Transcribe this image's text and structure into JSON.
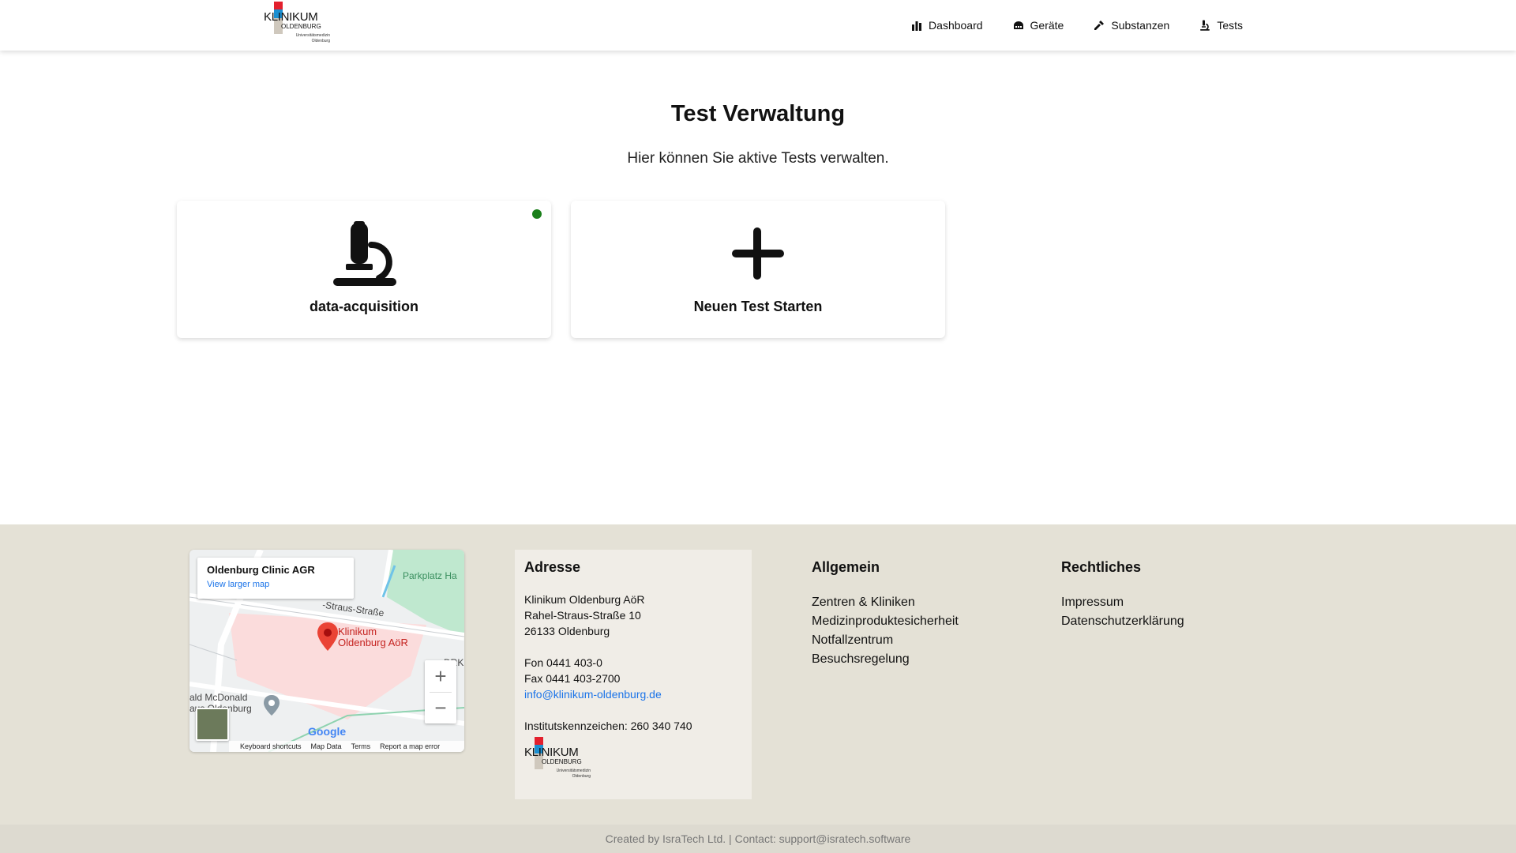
{
  "header": {
    "logo": {
      "name": "KLINIKUM",
      "sub": "OLDENBURG",
      "sub2_line1": "Universitätsmedizin",
      "sub2_line2": "Oldenburg"
    },
    "nav": [
      {
        "label": "Dashboard",
        "icon": "bar-chart-icon"
      },
      {
        "label": "Geräte",
        "icon": "device-icon"
      },
      {
        "label": "Substanzen",
        "icon": "pipette-icon"
      },
      {
        "label": "Tests",
        "icon": "microscope-icon"
      }
    ]
  },
  "main": {
    "title": "Test Verwaltung",
    "subtitle": "Hier können Sie aktive Tests verwalten.",
    "cards": [
      {
        "label": "data-acquisition",
        "icon": "microscope-icon",
        "status_color": "#1a7f1a"
      },
      {
        "label": "Neuen Test Starten",
        "icon": "plus-icon"
      }
    ]
  },
  "footer": {
    "map": {
      "place_title": "Oldenburg Clinic AGR",
      "view_larger": "View larger map",
      "pin_label_line1": "Klinikum",
      "pin_label_line2": "Oldenburg AöR",
      "street_label": "-Straus-Straße",
      "parking_label": "Parkplatz Ha",
      "mcdonald_line1": "ald McDonald",
      "mcdonald_line2": "aus Oldenburg",
      "drk_label": "DRK",
      "google": "Google",
      "bar": [
        "Keyboard shortcuts",
        "Map Data",
        "Terms",
        "Report a map error"
      ]
    },
    "address": {
      "title": "Adresse",
      "line1": "Klinikum Oldenburg AöR",
      "line2": "Rahel-Straus-Straße 10",
      "line3": "26133 Oldenburg",
      "fon": "Fon 0441 403-0",
      "fax": "Fax 0441 403-2700",
      "email": "info@klinikum-oldenburg.de",
      "institut": "Institutskennzeichen: 260 340 740"
    },
    "allgemein": {
      "title": "Allgemein",
      "links": [
        "Zentren & Kliniken",
        "Medizinproduktesicherheit",
        "Notfallzentrum",
        "Besuchsregelung"
      ]
    },
    "rechtliches": {
      "title": "Rechtliches",
      "links": [
        "Impressum",
        "Datenschutzerklärung"
      ]
    },
    "credits": "Created by IsraTech Ltd. | Contact: support@isratech.software"
  },
  "colors": {
    "footer_bg": "#e4e1d6",
    "address_bg": "#f0ede7",
    "link": "#1a73e8",
    "logo_red": "#e3202d",
    "logo_blue": "#1b8fd1",
    "status_green": "#1a7f1a"
  }
}
